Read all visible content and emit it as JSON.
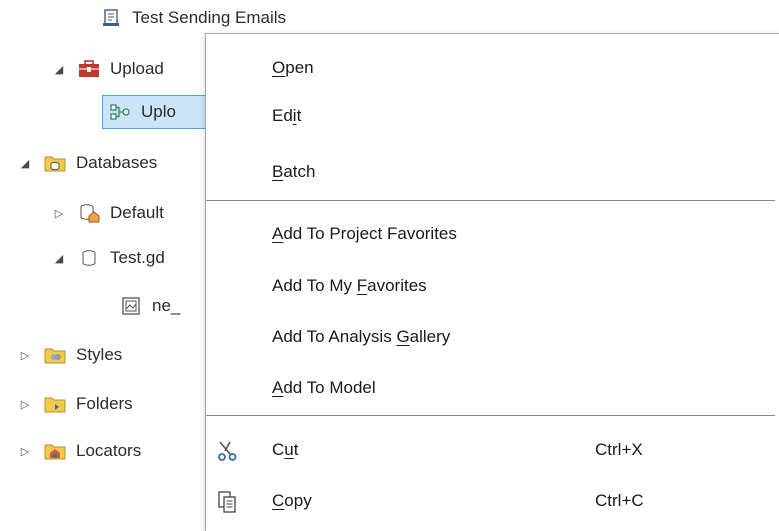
{
  "tree": {
    "items": [
      {
        "label": "Test Sending Emails",
        "icon": "script-icon"
      },
      {
        "label": "Upload",
        "icon": "toolbox-icon",
        "expanded": true
      },
      {
        "label": "Uplo",
        "icon": "model-icon",
        "selected": true
      },
      {
        "label": "Databases",
        "icon": "databases-folder-icon",
        "expanded": true
      },
      {
        "label": "Default",
        "icon": "default-geodatabase-icon",
        "expanded": false
      },
      {
        "label": "Test.gd",
        "icon": "geodatabase-icon",
        "expanded": true
      },
      {
        "label": "ne_",
        "icon": "raster-dataset-icon"
      },
      {
        "label": "Styles",
        "icon": "styles-folder-icon",
        "expanded": false
      },
      {
        "label": "Folders",
        "icon": "folders-icon",
        "expanded": false
      },
      {
        "label": "Locators",
        "icon": "locators-folder-icon",
        "expanded": false
      }
    ]
  },
  "context_menu": {
    "items": [
      {
        "pre": "",
        "key": "O",
        "post": "pen"
      },
      {
        "pre": "Ed",
        "key": "i",
        "post": "t"
      },
      {
        "pre": "",
        "key": "B",
        "post": "atch"
      },
      {
        "pre": "",
        "key": "A",
        "post": "dd To Project Favorites"
      },
      {
        "pre": "Add To My ",
        "key": "F",
        "post": "avorites"
      },
      {
        "pre": "Add To Analysis ",
        "key": "G",
        "post": "allery"
      },
      {
        "pre": "",
        "key": "A",
        "post": "dd To Model"
      },
      {
        "pre": "C",
        "key": "u",
        "post": "t",
        "shortcut": "Ctrl+X",
        "icon": "scissors-icon"
      },
      {
        "pre": "",
        "key": "C",
        "post": "opy",
        "shortcut": "Ctrl+C",
        "icon": "copy-icon"
      }
    ]
  },
  "colors": {
    "selection_bg": "#cce4f7",
    "selection_border": "#4aa3e6",
    "separator": "#8a8a8a"
  }
}
